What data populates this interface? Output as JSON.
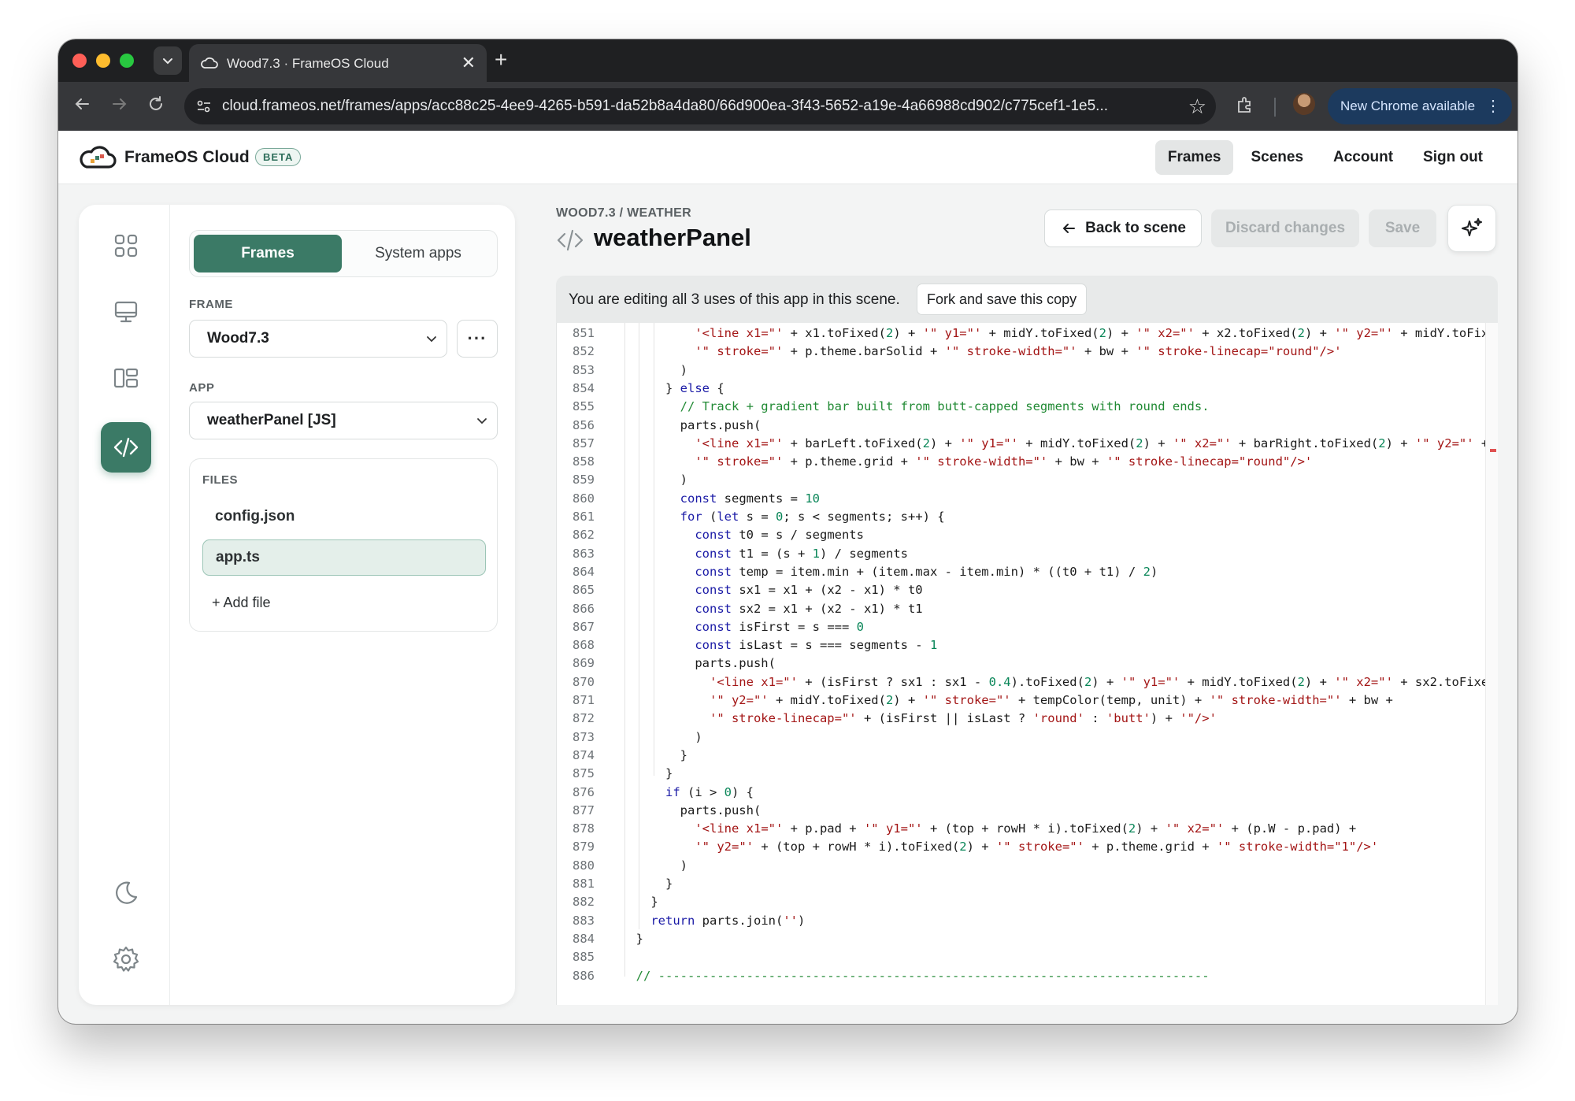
{
  "browser": {
    "tab_title": "Wood7.3 · FrameOS Cloud",
    "tab_close": "✕",
    "new_tab": "+",
    "url": "cloud.frameos.net/frames/apps/acc88c25-4ee9-4265-b591-da52b8a4da80/66d900ea-3f43-5652-a19e-4a66988cd902/c775cef1-1e5...",
    "update_label": "New Chrome available"
  },
  "header": {
    "brand": "FrameOS Cloud",
    "badge": "BETA",
    "nav": [
      "Frames",
      "Scenes",
      "Account",
      "Sign out"
    ],
    "active_nav": "Frames"
  },
  "sidebar": {
    "tabs": [
      "Frames",
      "System apps"
    ],
    "frame_label": "FRAME",
    "frame_value": "Wood7.3",
    "more_label": "···",
    "app_label": "APP",
    "app_value": "weatherPanel [JS]",
    "files_label": "FILES",
    "files": [
      "config.json",
      "app.ts"
    ],
    "active_file": "app.ts",
    "add_file": "+ Add file"
  },
  "main": {
    "breadcrumb": "WOOD7.3 / WEATHER",
    "title": "weatherPanel",
    "back_button": "Back to scene",
    "discard_button": "Discard changes",
    "save_button": "Save",
    "notice_text": "You are editing all 3 uses of this app in this scene.",
    "fork_button": "Fork and save this copy"
  },
  "editor": {
    "lines": [
      {
        "n": "851",
        "t": "          '<line x1=\"' + x1.toFixed(2) + '\" y1=\"' + midY.toFixed(2) + '\" x2=\"' + x2.toFixed(2) + '\" y2=\"' + midY.toFixe"
      },
      {
        "n": "852",
        "t": "          '\" stroke=\"' + p.theme.barSolid + '\" stroke-width=\"' + bw + '\" stroke-linecap=\"round\"/>'"
      },
      {
        "n": "853",
        "t": "        )"
      },
      {
        "n": "854",
        "t": "      } else {"
      },
      {
        "n": "855",
        "t": "        // Track + gradient bar built from butt-capped segments with round ends."
      },
      {
        "n": "856",
        "t": "        parts.push("
      },
      {
        "n": "857",
        "t": "          '<line x1=\"' + barLeft.toFixed(2) + '\" y1=\"' + midY.toFixed(2) + '\" x2=\"' + barRight.toFixed(2) + '\" y2=\"' +"
      },
      {
        "n": "858",
        "t": "          '\" stroke=\"' + p.theme.grid + '\" stroke-width=\"' + bw + '\" stroke-linecap=\"round\"/>'"
      },
      {
        "n": "859",
        "t": "        )"
      },
      {
        "n": "860",
        "t": "        const segments = 10"
      },
      {
        "n": "861",
        "t": "        for (let s = 0; s < segments; s++) {"
      },
      {
        "n": "862",
        "t": "          const t0 = s / segments"
      },
      {
        "n": "863",
        "t": "          const t1 = (s + 1) / segments"
      },
      {
        "n": "864",
        "t": "          const temp = item.min + (item.max - item.min) * ((t0 + t1) / 2)"
      },
      {
        "n": "865",
        "t": "          const sx1 = x1 + (x2 - x1) * t0"
      },
      {
        "n": "866",
        "t": "          const sx2 = x1 + (x2 - x1) * t1"
      },
      {
        "n": "867",
        "t": "          const isFirst = s === 0"
      },
      {
        "n": "868",
        "t": "          const isLast = s === segments - 1"
      },
      {
        "n": "869",
        "t": "          parts.push("
      },
      {
        "n": "870",
        "t": "            '<line x1=\"' + (isFirst ? sx1 : sx1 - 0.4).toFixed(2) + '\" y1=\"' + midY.toFixed(2) + '\" x2=\"' + sx2.toFixed"
      },
      {
        "n": "871",
        "t": "            '\" y2=\"' + midY.toFixed(2) + '\" stroke=\"' + tempColor(temp, unit) + '\" stroke-width=\"' + bw +"
      },
      {
        "n": "872",
        "t": "            '\" stroke-linecap=\"' + (isFirst || isLast ? 'round' : 'butt') + '\"/>'"
      },
      {
        "n": "873",
        "t": "          )"
      },
      {
        "n": "874",
        "t": "        }"
      },
      {
        "n": "875",
        "t": "      }"
      },
      {
        "n": "876",
        "t": "      if (i > 0) {"
      },
      {
        "n": "877",
        "t": "        parts.push("
      },
      {
        "n": "878",
        "t": "          '<line x1=\"' + p.pad + '\" y1=\"' + (top + rowH * i).toFixed(2) + '\" x2=\"' + (p.W - p.pad) +"
      },
      {
        "n": "879",
        "t": "          '\" y2=\"' + (top + rowH * i).toFixed(2) + '\" stroke=\"' + p.theme.grid + '\" stroke-width=\"1\"/>'"
      },
      {
        "n": "880",
        "t": "        )"
      },
      {
        "n": "881",
        "t": "      }"
      },
      {
        "n": "882",
        "t": "    }"
      },
      {
        "n": "883",
        "t": "    return parts.join('')"
      },
      {
        "n": "884",
        "t": "  }"
      },
      {
        "n": "885",
        "t": ""
      },
      {
        "n": "886",
        "t": "  // ---------------------------------------------------------------------------"
      }
    ]
  },
  "colors": {
    "accent": "#3b7a66",
    "keyword": "#1a1aa6",
    "string": "#a31515",
    "number": "#098658",
    "comment": "#218a34"
  }
}
